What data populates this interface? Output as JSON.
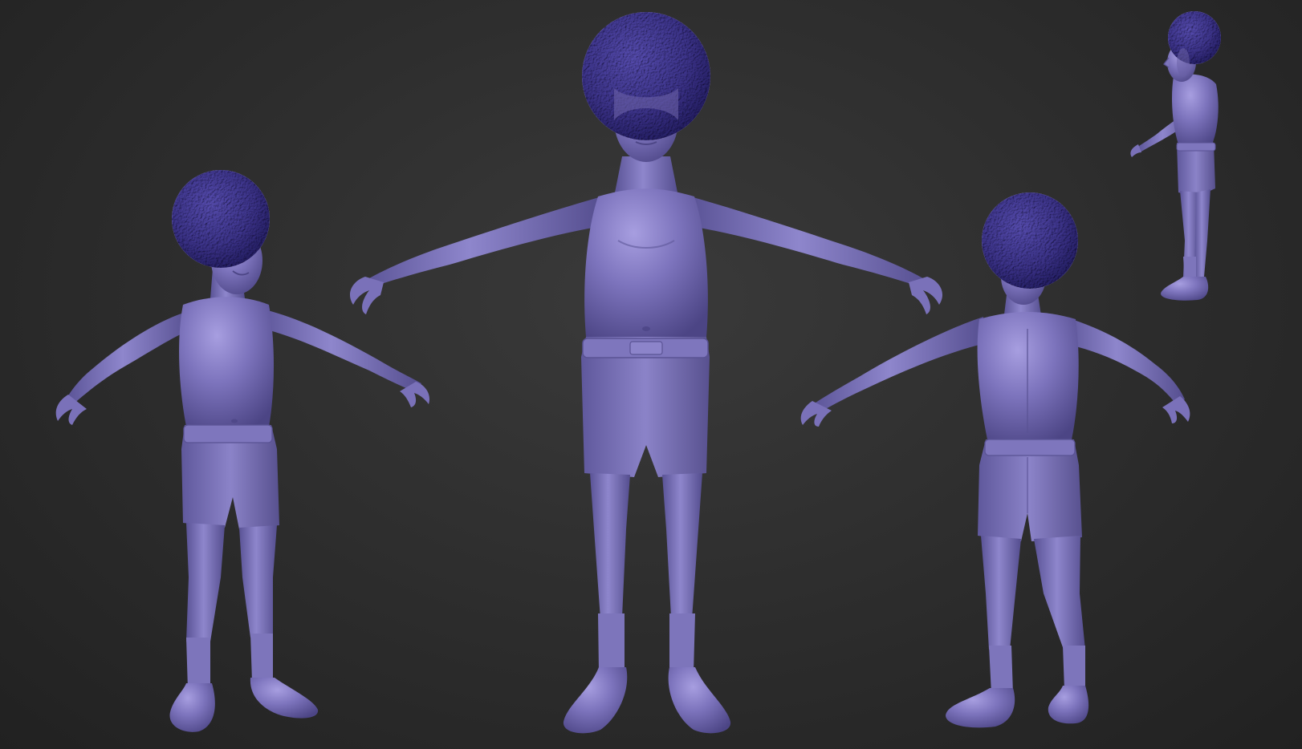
{
  "viewport": {
    "background_color": "#2c2c2c",
    "model_color": "#7b72b8"
  },
  "views": [
    {
      "name": "three-quarter-front-view"
    },
    {
      "name": "front-view"
    },
    {
      "name": "back-view"
    },
    {
      "name": "side-view"
    }
  ]
}
